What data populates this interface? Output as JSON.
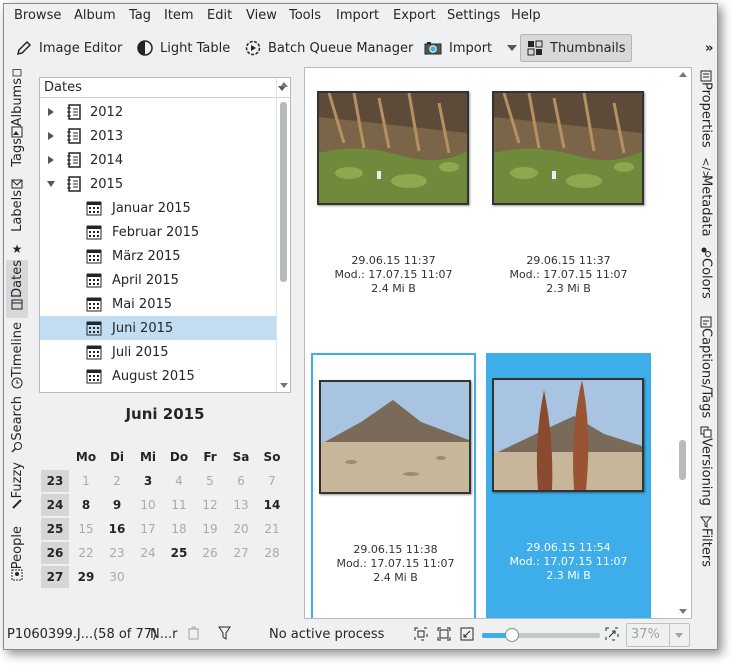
{
  "menu": [
    "Browse",
    "Album",
    "Tag",
    "Item",
    "Edit",
    "View",
    "Tools",
    "Import",
    "Export",
    "Settings",
    "Help"
  ],
  "toolbar": {
    "image_editor": "Image Editor",
    "light_table": "Light Table",
    "batch_queue": "Batch Queue Manager",
    "import": "Import",
    "thumbnails": "Thumbnails",
    "overflow": "»"
  },
  "left_tabs": [
    "Albums",
    "Tags",
    "Labels",
    "Dates",
    "Timeline",
    "Search",
    "Fuzzy",
    "People"
  ],
  "tree": {
    "header": "Dates",
    "years": [
      "2012",
      "2013",
      "2014",
      "2015"
    ],
    "months": [
      "Januar 2015",
      "Februar 2015",
      "März 2015",
      "April 2015",
      "Mai 2015",
      "Juni 2015",
      "Juli 2015",
      "August 2015"
    ],
    "selected": "Juni 2015"
  },
  "calendar": {
    "title": "Juni 2015",
    "weekday_headers": [
      "Mo",
      "Di",
      "Mi",
      "Do",
      "Fr",
      "Sa",
      "So"
    ],
    "weeks": [
      {
        "wk": "23",
        "days": [
          "1",
          "2",
          "3",
          "4",
          "5",
          "6",
          "7"
        ],
        "bold": [
          2
        ]
      },
      {
        "wk": "24",
        "days": [
          "8",
          "9",
          "10",
          "11",
          "12",
          "13",
          "14"
        ],
        "bold": [
          0,
          1,
          6
        ]
      },
      {
        "wk": "25",
        "days": [
          "15",
          "16",
          "17",
          "18",
          "19",
          "20",
          "21"
        ],
        "bold": [
          1
        ]
      },
      {
        "wk": "26",
        "days": [
          "22",
          "23",
          "24",
          "25",
          "26",
          "27",
          "28"
        ],
        "bold": [
          3
        ]
      },
      {
        "wk": "27",
        "days": [
          "29",
          "30",
          "",
          "",
          "",
          "",
          ""
        ],
        "bold": [
          0
        ]
      }
    ]
  },
  "thumbnails": [
    {
      "date": "29.06.15 11:37",
      "mod": "Mod.: 17.07.15 11:07",
      "size": "2.4 Mi B",
      "state": "normal"
    },
    {
      "date": "29.06.15 11:37",
      "mod": "Mod.: 17.07.15 11:07",
      "size": "2.3 Mi B",
      "state": "normal"
    },
    {
      "date": "29.06.15 11:38",
      "mod": "Mod.: 17.07.15 11:07",
      "size": "2.4 Mi B",
      "state": "current"
    },
    {
      "date": "29.06.15 11:54",
      "mod": "Mod.: 17.07.15 11:07",
      "size": "2.3 Mi B",
      "state": "selected"
    }
  ],
  "right_tabs": [
    "Properties",
    "Metadata",
    "Colors",
    "Captions/Tags",
    "Versioning",
    "Filters"
  ],
  "status": {
    "file": "P1060399.J...(58 of 77)",
    "filter": "N...r",
    "process": "No active process",
    "zoom": "37%",
    "zoom_fraction": 0.22
  },
  "colors": {
    "accent": "#3daee9",
    "selection": "#c2ddf2"
  }
}
